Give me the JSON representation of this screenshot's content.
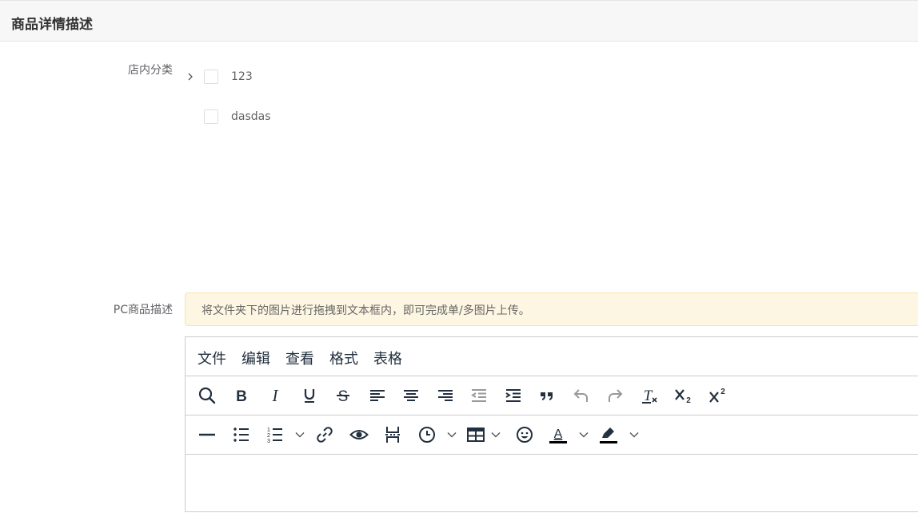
{
  "section": {
    "title": "商品详情描述"
  },
  "category": {
    "label": "店内分类",
    "items": [
      {
        "label": "123",
        "expandable": true,
        "checked": false
      },
      {
        "label": "dasdas",
        "expandable": false,
        "checked": false
      }
    ]
  },
  "description": {
    "label": "PC商品描述",
    "notice": "将文件夹下的图片进行拖拽到文本框内，即可完成单/多图片上传。"
  },
  "editor": {
    "menus": [
      "文件",
      "编辑",
      "查看",
      "格式",
      "表格"
    ],
    "toolbar_row1": [
      "search-icon",
      "bold-icon",
      "italic-icon",
      "underline-icon",
      "strikethrough-icon",
      "align-left-icon",
      "align-center-icon",
      "align-right-icon",
      "outdent-icon",
      "indent-icon",
      "blockquote-icon",
      "undo-icon",
      "redo-icon",
      "remove-format-icon",
      "subscript-icon",
      "superscript-icon"
    ],
    "toolbar_row2": [
      "horizontal-line-icon",
      "bullet-list-icon",
      "numbered-list-icon",
      "link-icon",
      "preview-icon",
      "page-break-icon",
      "insert-time-icon",
      "table-icon",
      "emoji-icon",
      "text-color-icon",
      "highlight-color-icon"
    ],
    "colors": {
      "icon": "#222f3e",
      "disabled_icon": "#999999",
      "text_color_bar": "#000000"
    }
  }
}
